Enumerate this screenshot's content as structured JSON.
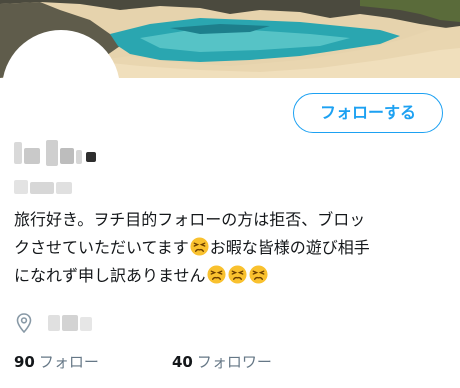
{
  "profile": {
    "follow_button_label": "フォローする",
    "bio_lines": [
      "旅行好き。ヲチ目的フォローの方は拒否、ブロッ",
      "クさせていただいてます",
      "お暇な皆様の遊び相手",
      "になれず申し訳ありません"
    ],
    "emoji_icon": "persevering-face-icon",
    "location_icon": "location-pin-icon"
  },
  "stats": {
    "following": {
      "count": "90",
      "label": "フォロー"
    },
    "followers": {
      "count": "40",
      "label": "フォロワー"
    }
  },
  "colors": {
    "accent": "#1da1f2",
    "text": "#14171a",
    "muted": "#657786",
    "emoji": "#f9c12e"
  }
}
